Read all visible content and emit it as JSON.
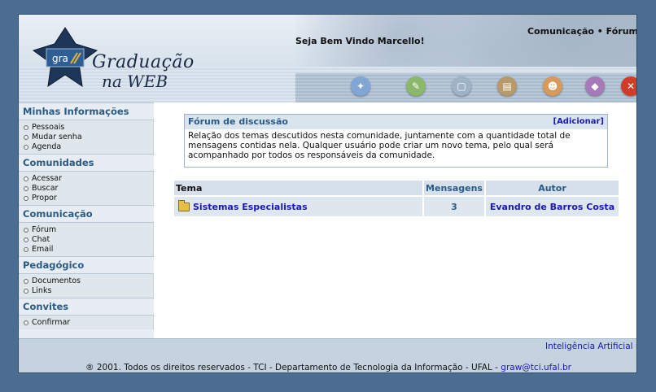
{
  "header": {
    "logo_line1": "Graduação",
    "logo_line2": "na WEB",
    "logo_badge": "gra",
    "welcome": "Seja Bem Vindo Marcello!",
    "breadcrumb": "Comunicação • Fórum",
    "toolbar_icons": [
      "globe-icon",
      "tools-icon",
      "notebook-icon",
      "book-icon",
      "user-icon",
      "folder-icon",
      "close-icon"
    ]
  },
  "sidebar": {
    "sections": [
      {
        "title": "Minhas Informações",
        "links": [
          "Pessoais",
          "Mudar senha",
          "Agenda"
        ]
      },
      {
        "title": "Comunidades",
        "links": [
          "Acessar",
          "Buscar",
          "Propor"
        ]
      },
      {
        "title": "Comunicação",
        "links": [
          "Fórum",
          "Chat",
          "Email"
        ]
      },
      {
        "title": "Pedagógico",
        "links": [
          "Documentos",
          "Links"
        ]
      },
      {
        "title": "Convites",
        "links": [
          "Confirmar"
        ]
      }
    ]
  },
  "forum": {
    "title": "Fórum de discussão",
    "add_label": "[Adicionar]",
    "description": "Relação dos temas descutidos nesta comunidade, juntamente com a quantidade total de mensagens contidas nela. Qualquer usuário pode criar um novo tema, pelo qual será acompanhado por todos os responsáveis da comunidade."
  },
  "table": {
    "headers": {
      "tema": "Tema",
      "mensagens": "Mensagens",
      "autor": "Autor"
    },
    "rows": [
      {
        "tema": "Sistemas Especialistas",
        "mensagens": "3",
        "autor": "Evandro de Barros Costa"
      }
    ]
  },
  "footer": {
    "course": "Inteligência Artificial I",
    "copyright": "® 2001. Todos os direitos reservados - TCI - Departamento de Tecnologia da Informação - UFAL - ",
    "email": "graw@tci.ufal.br"
  },
  "colors": {
    "page_bg": "#4a6d91",
    "section_title": "#2a5b88",
    "link": "#1a1ab0"
  }
}
